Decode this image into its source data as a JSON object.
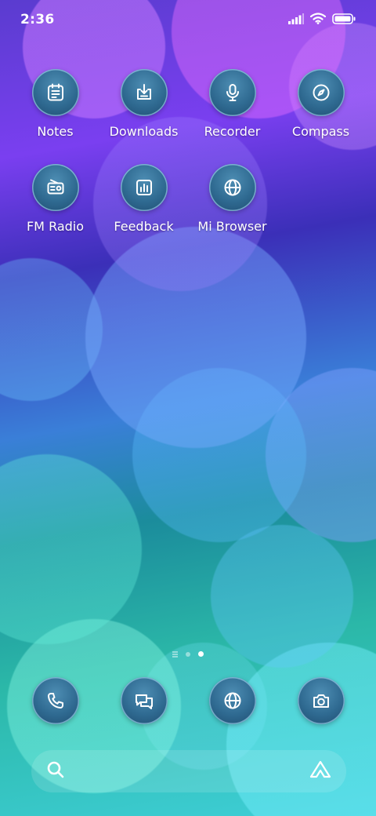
{
  "status_bar": {
    "time": "2:36",
    "icons": [
      "signal-icon",
      "wifi-icon",
      "battery-icon"
    ]
  },
  "apps": [
    {
      "label": "Notes",
      "icon": "notes-icon"
    },
    {
      "label": "Downloads",
      "icon": "download-icon"
    },
    {
      "label": "Recorder",
      "icon": "microphone-icon"
    },
    {
      "label": "Compass",
      "icon": "compass-icon"
    },
    {
      "label": "FM Radio",
      "icon": "radio-icon"
    },
    {
      "label": "Feedback",
      "icon": "feedback-chart-icon"
    },
    {
      "label": "Mi Browser",
      "icon": "globe-icon"
    }
  ],
  "page_indicator": {
    "pages": 3,
    "active_index": 2
  },
  "dock": [
    {
      "icon": "phone-icon"
    },
    {
      "icon": "messages-icon"
    },
    {
      "icon": "globe-icon"
    },
    {
      "icon": "camera-icon"
    }
  ],
  "search_bar": {
    "left_icon": "search-icon",
    "right_icon": "assistant-icon"
  },
  "colors": {
    "icon_fill": "#2f6a91",
    "icon_ring": "#b4e6ff",
    "text": "#ffffff"
  }
}
